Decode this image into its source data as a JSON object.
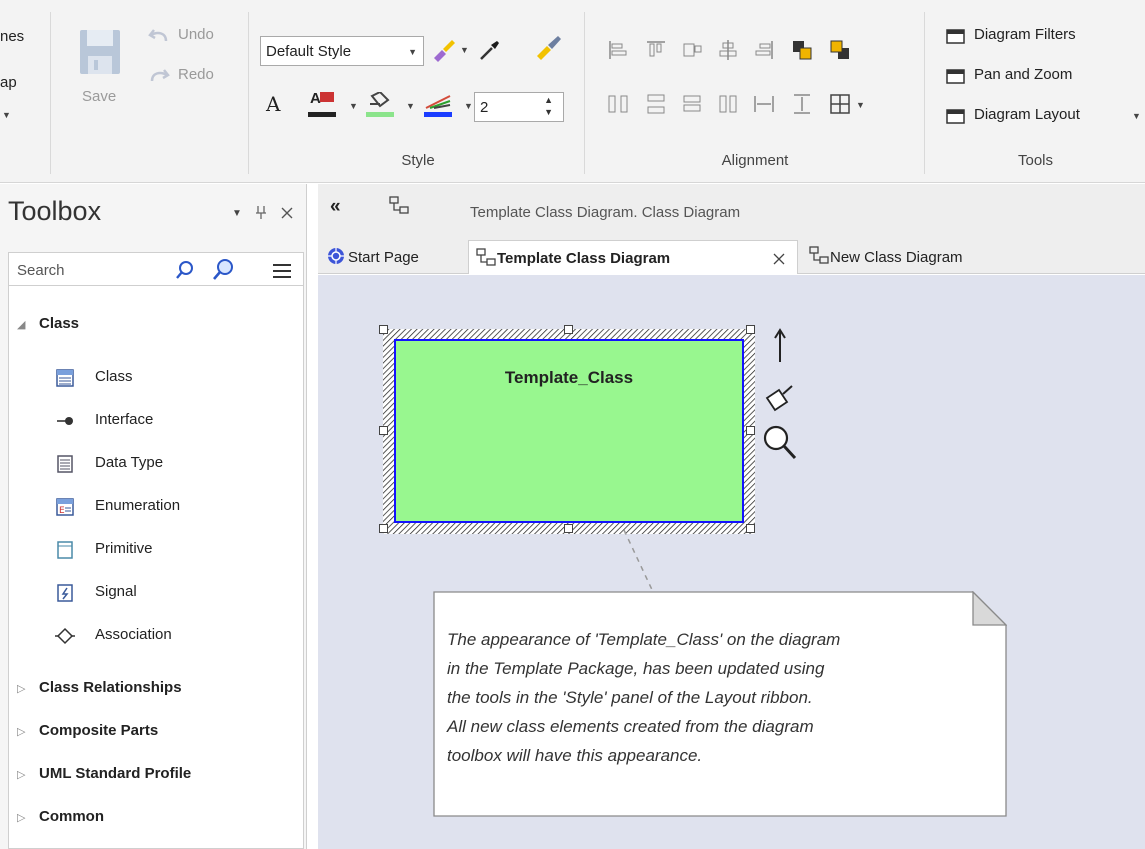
{
  "ribbon": {
    "left_partial": [
      "nes",
      "ap"
    ],
    "save_label": "Save",
    "undo_label": "Undo",
    "redo_label": "Redo",
    "style_combo_value": "Default Style",
    "line_width_value": "2",
    "groups": {
      "style": "Style",
      "alignment": "Alignment",
      "tools": "Tools"
    },
    "tools": {
      "diagram_filters": "Diagram Filters",
      "pan_and_zoom": "Pan and Zoom",
      "diagram_layout": "Diagram Layout"
    },
    "colors": {
      "font_color": "#222222",
      "fill_color": "#8be48b",
      "line_color": "#1a3cff"
    }
  },
  "toolbox": {
    "title": "Toolbox",
    "search_placeholder": "Search",
    "open_category": "Class",
    "items": [
      {
        "label": "Class",
        "icon": "class-icon"
      },
      {
        "label": "Interface",
        "icon": "interface-icon"
      },
      {
        "label": "Data Type",
        "icon": "data-type-icon"
      },
      {
        "label": "Enumeration",
        "icon": "enumeration-icon"
      },
      {
        "label": "Primitive",
        "icon": "primitive-icon"
      },
      {
        "label": "Signal",
        "icon": "signal-icon"
      },
      {
        "label": "Association",
        "icon": "association-icon"
      }
    ],
    "categories": [
      "Class Relationships",
      "Composite Parts",
      "UML Standard Profile",
      "Common"
    ]
  },
  "diagram": {
    "header_title": "Template Class Diagram.  Class Diagram",
    "tabs": [
      "Start Page",
      "Template Class Diagram",
      "New Class Diagram"
    ],
    "active_tab": "Template Class Diagram",
    "class_element": {
      "name": "Template_Class",
      "fill_color": "#98f78f",
      "border_color": "#1212ff"
    },
    "note": [
      "The appearance of 'Template_Class' on the diagram",
      "in the Template Package, has been updated using",
      "the tools in the 'Style' panel of the Layout ribbon.",
      "All new class elements created from the diagram",
      "toolbox will have this appearance."
    ]
  }
}
